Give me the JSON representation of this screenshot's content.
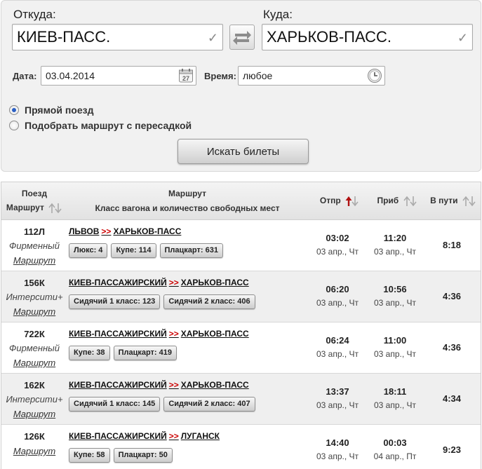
{
  "search": {
    "from_label": "Откуда:",
    "from_value": "КИЕВ-ПАСС.",
    "to_label": "Куда:",
    "to_value": "ХАРЬКОВ-ПАСС.",
    "date_label": "Дата:",
    "date_value": "03.04.2014",
    "calendar_day": "27",
    "time_label": "Время:",
    "time_value": "любое",
    "option_direct": "Прямой поезд",
    "option_transfer": "Подобрать маршрут с пересадкой",
    "search_button": "Искать билеты"
  },
  "table": {
    "headers": {
      "train": "Поезд",
      "route_col": "Маршрут",
      "route_title": "Маршрут",
      "route_sub": "Класс вагона и количество свободных мест",
      "depart": "Отпр",
      "arrive": "Приб",
      "duration": "В пути"
    },
    "route_link_label": "Маршрут",
    "route_arrow": ">>",
    "rows": [
      {
        "number": "112Л",
        "type": "Фирменный",
        "from": "ЛЬВОВ",
        "to": "ХАРЬКОВ-ПАСС",
        "seats": [
          "Люкс: 4",
          "Купе: 114",
          "Плацкарт: 631"
        ],
        "dep_time": "03:02",
        "dep_date": "03 апр., Чт",
        "arr_time": "11:20",
        "arr_date": "03 апр., Чт",
        "duration": "8:18"
      },
      {
        "number": "156К",
        "type": "Интерсити+",
        "from": "КИЕВ-ПАССАЖИРСКИЙ",
        "to": "ХАРЬКОВ-ПАСС",
        "seats": [
          "Сидячий 1 класс: 123",
          "Сидячий 2 класс: 406"
        ],
        "dep_time": "06:20",
        "dep_date": "03 апр., Чт",
        "arr_time": "10:56",
        "arr_date": "03 апр., Чт",
        "duration": "4:36"
      },
      {
        "number": "722К",
        "type": "Фирменный",
        "from": "КИЕВ-ПАССАЖИРСКИЙ",
        "to": "ХАРЬКОВ-ПАСС",
        "seats": [
          "Купе: 38",
          "Плацкарт: 419"
        ],
        "dep_time": "06:24",
        "dep_date": "03 апр., Чт",
        "arr_time": "11:00",
        "arr_date": "03 апр., Чт",
        "duration": "4:36"
      },
      {
        "number": "162К",
        "type": "Интерсити+",
        "from": "КИЕВ-ПАССАЖИРСКИЙ",
        "to": "ХАРЬКОВ-ПАСС",
        "seats": [
          "Сидячий 1 класс: 145",
          "Сидячий 2 класс: 407"
        ],
        "dep_time": "13:37",
        "dep_date": "03 апр., Чт",
        "arr_time": "18:11",
        "arr_date": "03 апр., Чт",
        "duration": "4:34"
      },
      {
        "number": "126К",
        "type": "",
        "from": "КИЕВ-ПАССАЖИРСКИЙ",
        "to": "ЛУГАНСК",
        "seats": [
          "Купе: 58",
          "Плацкарт: 50"
        ],
        "dep_time": "14:40",
        "dep_date": "03 апр., Чт",
        "arr_time": "00:03",
        "arr_date": "04 апр., Пт",
        "duration": "9:23"
      }
    ]
  },
  "colors": {
    "route_arrow": "#cc0000",
    "sort_active": "#b01010",
    "radio_selected": "#2a5fc4"
  }
}
